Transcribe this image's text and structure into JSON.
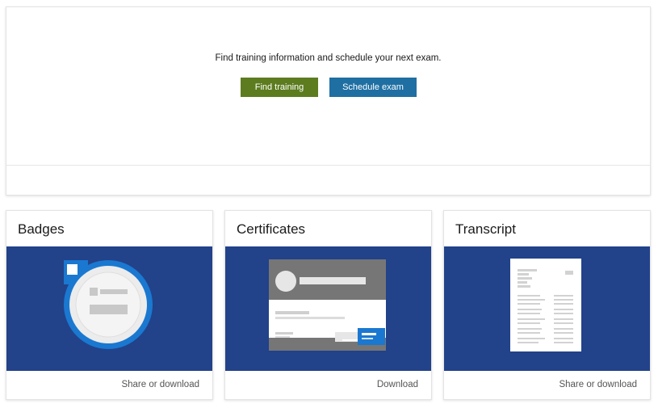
{
  "hero": {
    "message": "Find training information and schedule your next exam.",
    "find_training_label": "Find training",
    "schedule_exam_label": "Schedule exam"
  },
  "cards": [
    {
      "title": "Badges",
      "action": "Share or download"
    },
    {
      "title": "Certificates",
      "action": "Download"
    },
    {
      "title": "Transcript",
      "action": "Share or download"
    }
  ],
  "colors": {
    "green_button": "#5c7c1f",
    "blue_button": "#1f6fa3",
    "card_art_bg": "#22428a",
    "accent_blue": "#1a78d0"
  }
}
